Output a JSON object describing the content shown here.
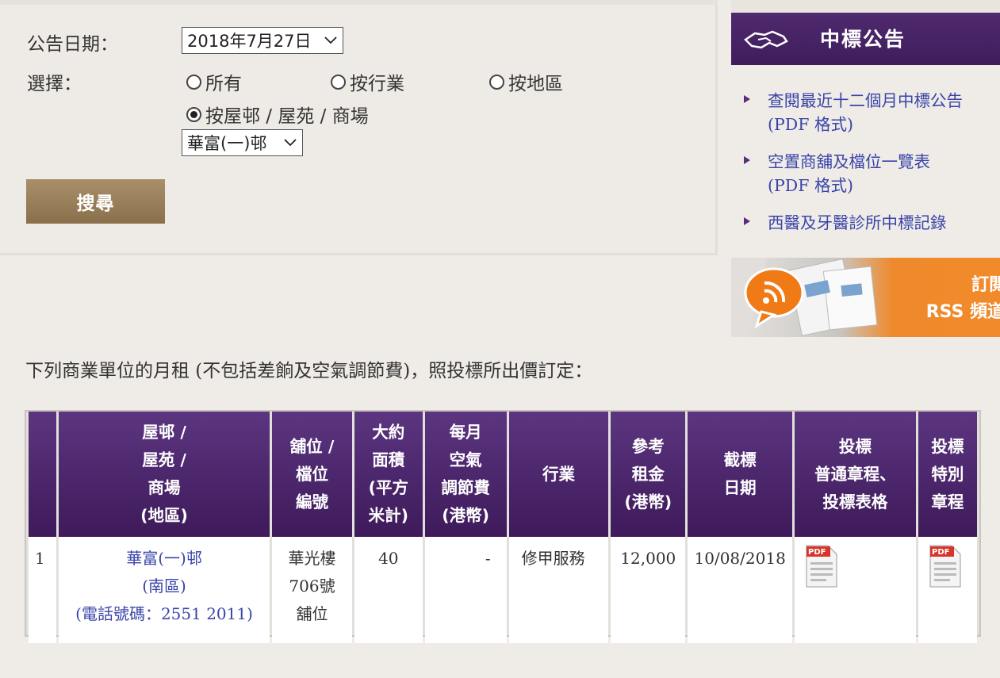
{
  "search": {
    "date_label": "公告日期：",
    "date_value": "2018年7月27日",
    "select_label": "選擇：",
    "radio_all": "所有",
    "radio_trade": "按行業",
    "radio_district": "按地區",
    "radio_estate": "按屋邨 / 屋苑 / 商場",
    "estate_value": "華富(一)邨",
    "search_button": "搜尋"
  },
  "sidebar": {
    "title": "中標公告",
    "links": [
      {
        "line1": "查閱最近十二個月中標公告",
        "line2": "(PDF 格式)"
      },
      {
        "line1": "空置商舖及檔位一覽表",
        "line2": "(PDF 格式)"
      },
      {
        "line1": "西醫及牙醫診所中標記錄",
        "line2": ""
      }
    ],
    "rss_line1": "訂閱",
    "rss_line2": "RSS 頻道"
  },
  "intro": "下列商業單位的月租 (不包括差餉及空氣調節費)，照投標所出價訂定：",
  "table": {
    "headers": {
      "estate": [
        "屋邨 /",
        "屋苑 /",
        "商場",
        "(地區)"
      ],
      "shop": [
        "舖位 /",
        "檔位",
        "編號"
      ],
      "area": [
        "大約",
        "面積",
        "(平方",
        "米計)"
      ],
      "ac": [
        "每月",
        "空氣",
        "調節費",
        "(港幣)"
      ],
      "trade": [
        "行業"
      ],
      "rent": [
        "參考",
        "租金",
        "(港幣)"
      ],
      "closing": [
        "截標",
        "日期"
      ],
      "general": [
        "投標",
        "普通章程、",
        "投標表格"
      ],
      "special": [
        "投標",
        "特別",
        "章程"
      ]
    },
    "rows": [
      {
        "no": "1",
        "estate": "華富(一)邨",
        "district": "(南區)",
        "phone": "(電話號碼：2551 2011)",
        "shop1": "華光樓",
        "shop2": "706號",
        "shop3": "舖位",
        "area": "40",
        "ac": "-",
        "trade": "修甲服務",
        "rent": "12,000",
        "closing": "10/08/2018"
      }
    ]
  },
  "icons": {
    "pdf": "pdf-icon",
    "rss": "rss-icon",
    "handshake": "handshake-icon"
  },
  "colors": {
    "purple": "#4f2a6e",
    "link": "#3a44a8",
    "button": "#a88f6a"
  }
}
